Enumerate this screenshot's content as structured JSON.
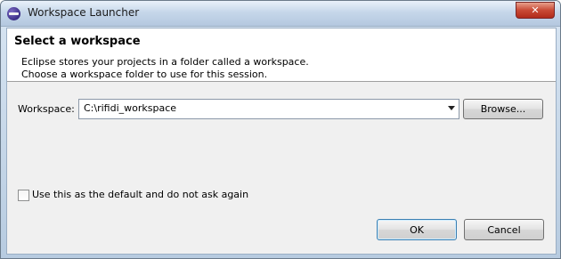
{
  "window": {
    "title": "Workspace Launcher"
  },
  "header": {
    "title": "Select a workspace",
    "desc_line1": "Eclipse stores your projects in a folder called a workspace.",
    "desc_line2": "Choose a workspace folder to use for this session."
  },
  "workspace": {
    "label": "Workspace:",
    "value": "C:\\rifidi_workspace"
  },
  "buttons": {
    "browse": "Browse...",
    "ok": "OK",
    "cancel": "Cancel"
  },
  "checkbox": {
    "label": "Use this as the default and do not ask again",
    "checked": false
  },
  "colors": {
    "title_bar": "#c6d7ea",
    "close_button": "#c94a35",
    "dialog_bg": "#f0f0f0"
  }
}
